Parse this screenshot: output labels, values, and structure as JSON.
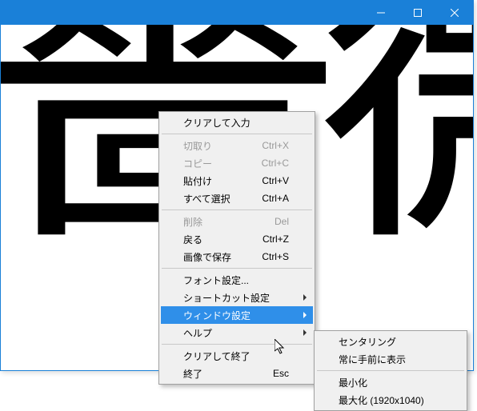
{
  "characters": "薔薇",
  "menu": {
    "clear_input": "クリアして入力",
    "cut": "切取り",
    "cut_sc": "Ctrl+X",
    "copy": "コピー",
    "copy_sc": "Ctrl+C",
    "paste": "貼付け",
    "paste_sc": "Ctrl+V",
    "select_all": "すべて選択",
    "select_all_sc": "Ctrl+A",
    "delete": "削除",
    "delete_sc": "Del",
    "undo": "戻る",
    "undo_sc": "Ctrl+Z",
    "save_image": "画像で保存",
    "save_image_sc": "Ctrl+S",
    "font_settings": "フォント設定...",
    "shortcut_settings": "ショートカット設定",
    "window_settings": "ウィンドウ設定",
    "help": "ヘルプ",
    "clear_exit": "クリアして終了",
    "exit": "終了",
    "exit_sc": "Esc"
  },
  "submenu": {
    "centering": "センタリング",
    "always_on_top": "常に手前に表示",
    "minimize": "最小化",
    "maximize": "最大化 (1920x1040)"
  }
}
